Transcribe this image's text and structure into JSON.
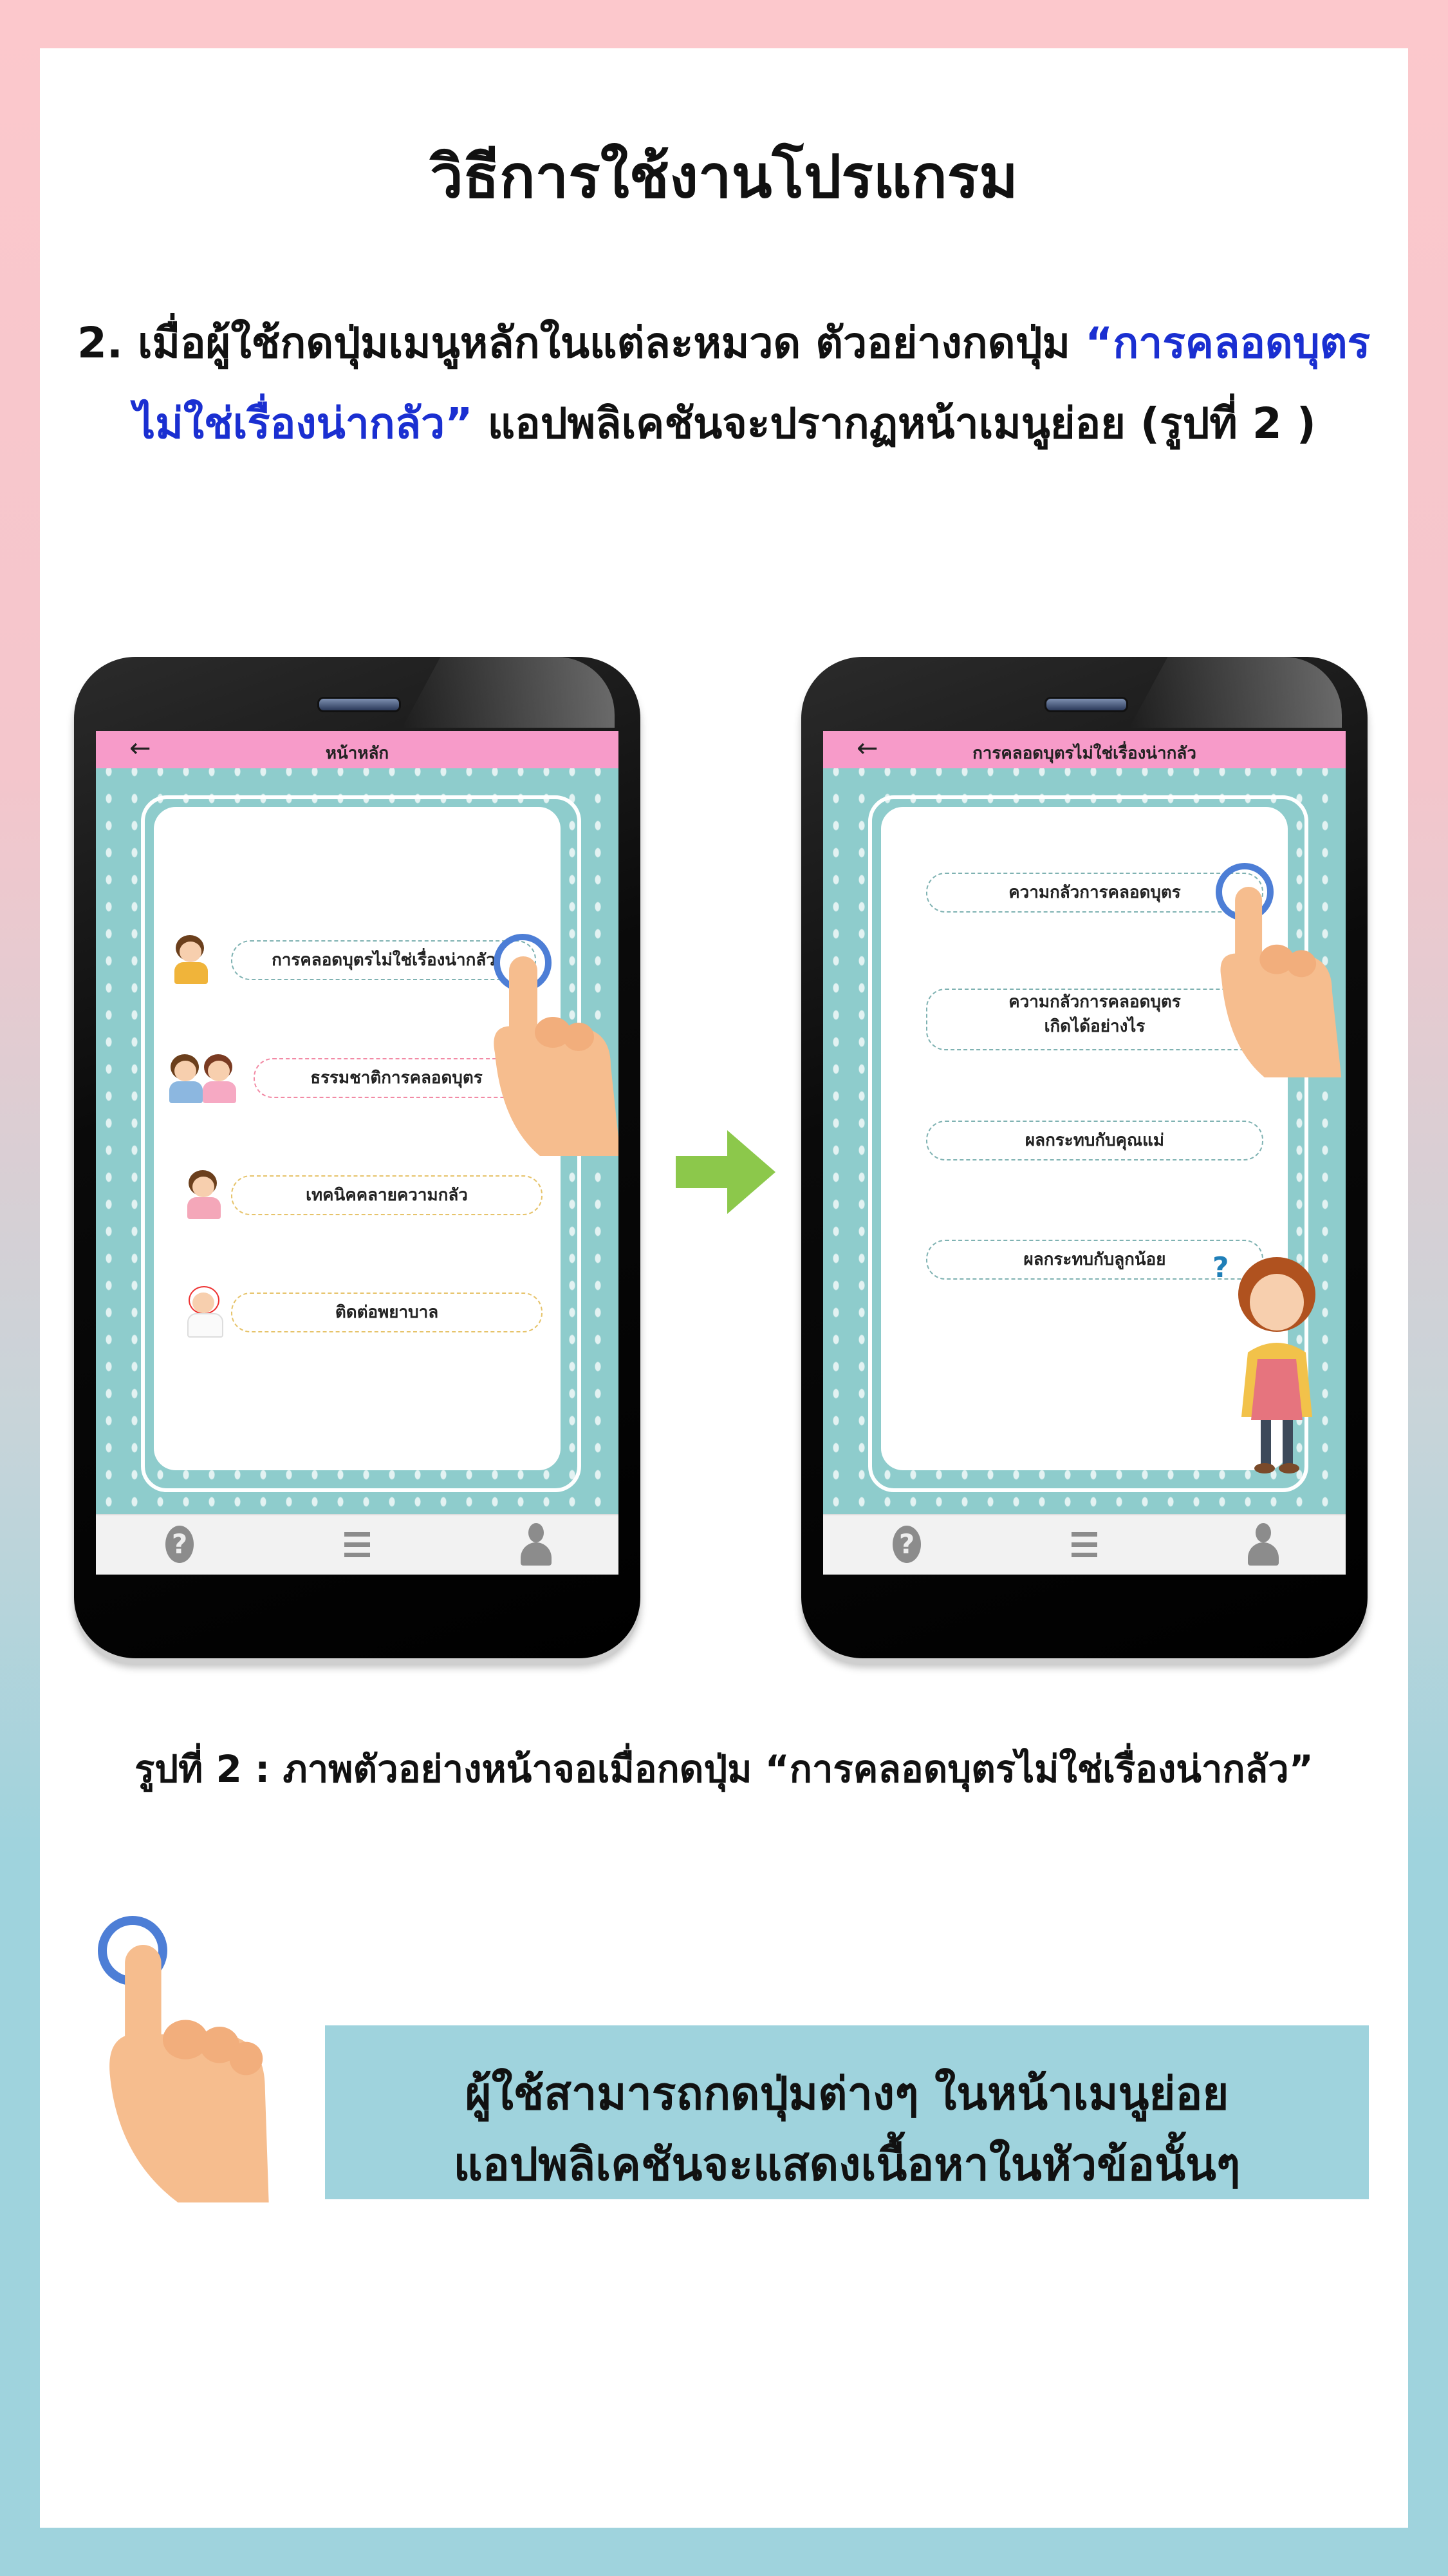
{
  "page": {
    "title": "วิธีการใช้งานโปรแกรม",
    "intro_prefix": "2. เมื่อผู้ใช้กดปุ่มเมนูหลักในแต่ละหมวด ตัวอย่างกดปุ่ม ",
    "intro_highlight_1": "“การคลอดบุตร",
    "intro_highlight_2": "ไม่ใช่เรื่องน่ากลัว”",
    "intro_suffix": " แอปพลิเคชันจะปรากฏหน้าเมนูย่อย (รูปที่ 2 )",
    "caption": "รูปที่ 2 : ภาพตัวอย่างหน้าจอเมื่อกดปุ่ม “การคลอดบุตรไม่ใช่เรื่องน่ากลัว”",
    "note_line_1": "ผู้ใช้สามารถกดปุ่มต่างๆ ในหน้าเมนูย่อย",
    "note_line_2": "แอปพลิเคชันจะแสดงเนื้อหาในหัวข้อนั้นๆ"
  },
  "phone_left": {
    "back_glyph": "←",
    "header_title": "หน้าหลัก",
    "menu": [
      {
        "label": "การคลอดบุตรไม่ใช่เรื่องน่ากลัว"
      },
      {
        "label": "ธรรมชาติการคลอดบุตร"
      },
      {
        "label": "เทคนิคคลายความกลัว"
      },
      {
        "label": "ติดต่อพยาบาล"
      }
    ],
    "nav_help_glyph": "?"
  },
  "phone_right": {
    "back_glyph": "←",
    "header_title": "การคลอดบุตรไม่ใช่เรื่องน่ากลัว",
    "menu": [
      {
        "label": "ความกลัวการคลอดบุตร"
      },
      {
        "label_line_1": "ความกลัวการคลอดบุตร",
        "label_line_2": "เกิดได้อย่างไร"
      },
      {
        "label": "ผลกระทบกับคุณแม่"
      },
      {
        "label": "ผลกระทบกับลูกน้อย"
      }
    ],
    "question_mark": "?",
    "nav_help_glyph": "?"
  },
  "colors": {
    "highlight": "#1a2fd1",
    "app_header": "#f79bc9",
    "screen_bg": "#8ecccc",
    "tap_ring": "#4d7ed6",
    "next_arrow": "#8cc84b",
    "note_bg": "#9fd3dd"
  },
  "icons": [
    "help-icon",
    "menu-icon",
    "profile-icon",
    "back-arrow-icon",
    "next-arrow-icon",
    "tap-hand-icon"
  ]
}
